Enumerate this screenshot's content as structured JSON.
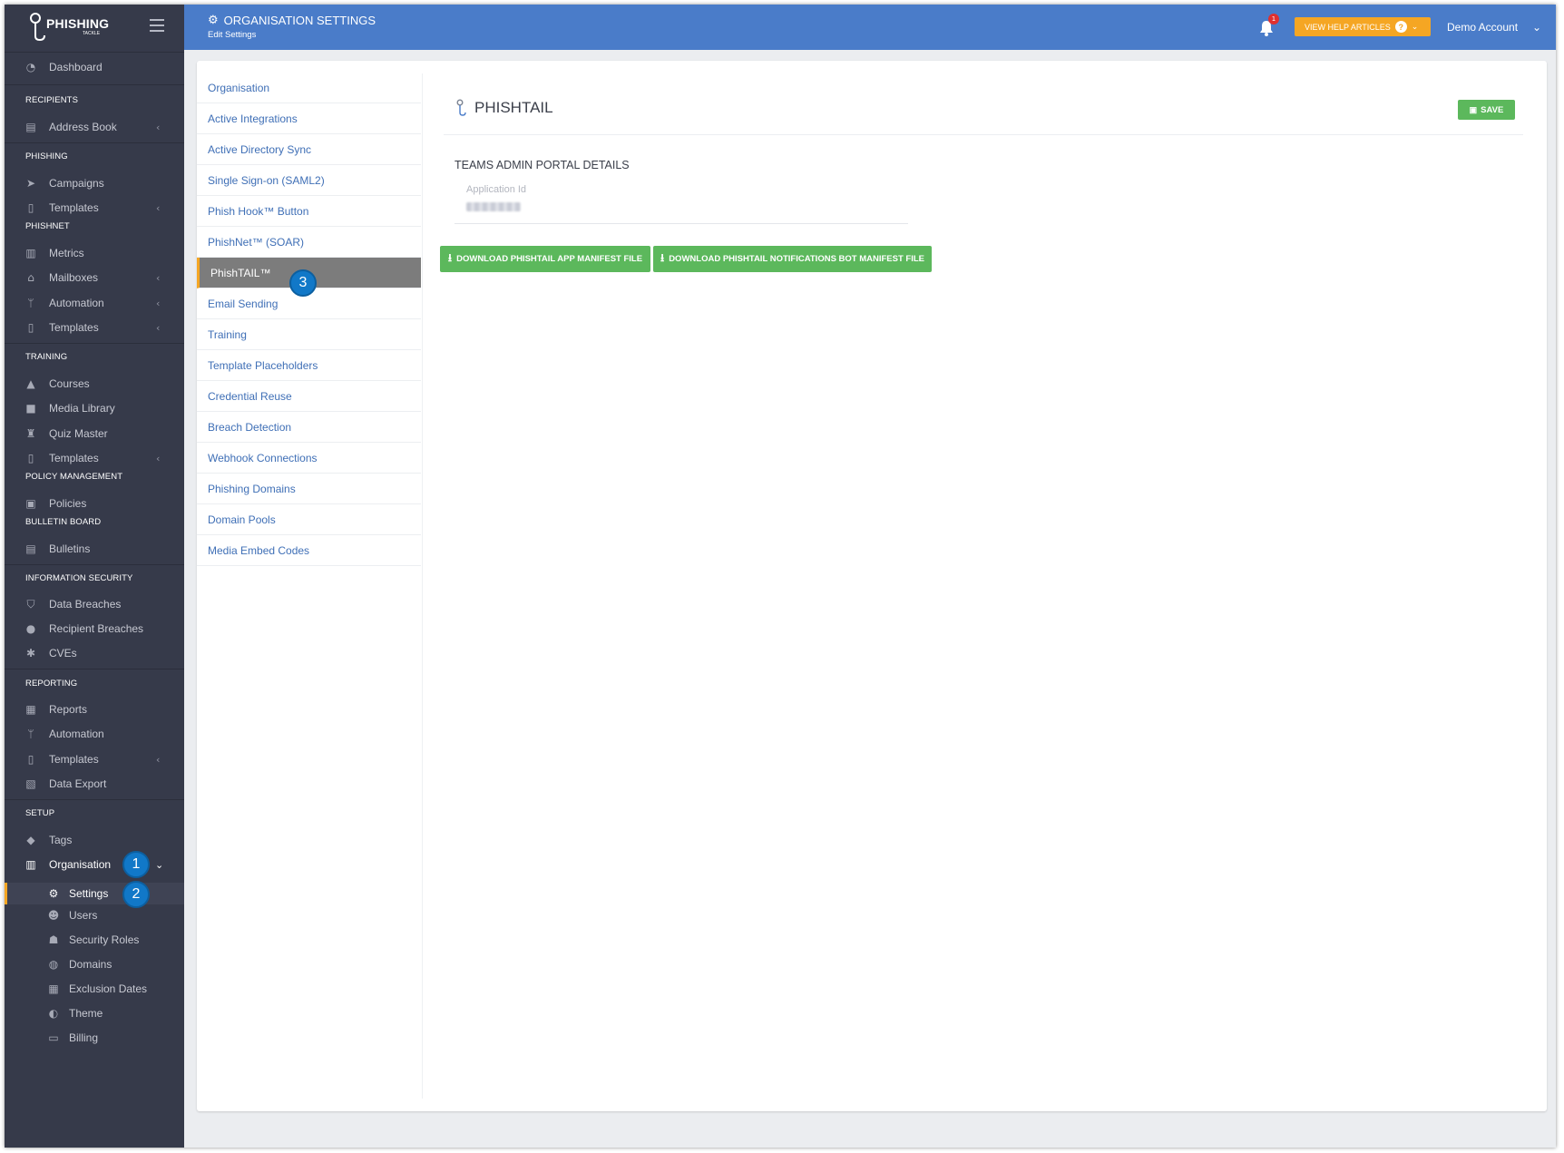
{
  "app": {
    "logo_text": "PHISHING",
    "logo_sub": "TACKLE"
  },
  "header": {
    "title": "ORGANISATION SETTINGS",
    "subtitle": "Edit Settings",
    "notification_count": "1",
    "help_label": "VIEW HELP ARTICLES",
    "account_label": "Demo Account"
  },
  "sidebar": {
    "dashboard": "Dashboard",
    "recipients_head": "RECIPIENTS",
    "address_book": "Address Book",
    "phishing_head": "PHISHING",
    "campaigns": "Campaigns",
    "phishing_templates": "Templates",
    "phishnet_head": "PHISHNET",
    "metrics": "Metrics",
    "mailboxes": "Mailboxes",
    "phishnet_automation": "Automation",
    "phishnet_templates": "Templates",
    "training_head": "TRAINING",
    "courses": "Courses",
    "media_library": "Media Library",
    "quiz_master": "Quiz Master",
    "training_templates": "Templates",
    "policy_head": "POLICY MANAGEMENT",
    "policies": "Policies",
    "bulletin_head": "BULLETIN BOARD",
    "bulletins": "Bulletins",
    "infosec_head": "INFORMATION SECURITY",
    "data_breaches": "Data Breaches",
    "recipient_breaches": "Recipient Breaches",
    "cves": "CVEs",
    "reporting_head": "REPORTING",
    "reports": "Reports",
    "reporting_automation": "Automation",
    "reporting_templates": "Templates",
    "data_export": "Data Export",
    "setup_head": "SETUP",
    "tags": "Tags",
    "organisation": "Organisation",
    "settings": "Settings",
    "users": "Users",
    "security_roles": "Security Roles",
    "domains": "Domains",
    "exclusion_dates": "Exclusion Dates",
    "theme": "Theme",
    "billing": "Billing"
  },
  "callouts": {
    "one": "1",
    "two": "2",
    "three": "3"
  },
  "settings_menu": {
    "items": [
      "Organisation",
      "Active Integrations",
      "Active Directory Sync",
      "Single Sign-on (SAML2)",
      "Phish Hook™ Button",
      "PhishNet™ (SOAR)",
      "PhishTAIL™",
      "Email Sending",
      "Training",
      "Template Placeholders",
      "Credential Reuse",
      "Breach Detection",
      "Webhook Connections",
      "Phishing Domains",
      "Domain Pools",
      "Media Embed Codes"
    ],
    "active_index": 6
  },
  "detail": {
    "heading": "PHISHTAIL",
    "save_label": "SAVE",
    "section_title": "TEAMS ADMIN PORTAL DETAILS",
    "field_label": "Application Id",
    "download_app_label": "DOWNLOAD PHISHTAIL APP MANIFEST FILE",
    "download_bot_label": "DOWNLOAD PHISHTAIL NOTIFICATIONS BOT MANIFEST FILE"
  },
  "colors": {
    "sidebar_bg": "#363a4a",
    "header_bg": "#4a7cc9",
    "accent_orange": "#f5a623",
    "success_green": "#5cb85c",
    "link_blue": "#3f6fb6",
    "callout_blue": "#1178c8"
  },
  "icons": {
    "dashboard": "tachometer-icon",
    "address_book": "address-book-icon",
    "campaigns": "paper-plane-icon",
    "templates": "file-icon",
    "metrics": "bar-chart-icon",
    "mailboxes": "inbox-icon",
    "automation": "code-branch-icon",
    "courses": "graduation-cap-icon",
    "media_library": "video-camera-icon",
    "quiz_master": "trophy-icon",
    "policies": "clipboard-check-icon",
    "bulletins": "newspaper-icon",
    "data_breaches": "shield-icon",
    "recipient_breaches": "user-lock-icon",
    "cves": "bug-icon",
    "reports": "print-icon",
    "data_export": "file-excel-icon",
    "tags": "tags-icon",
    "organisation": "building-icon",
    "settings": "gear-icon",
    "users": "users-icon",
    "security_roles": "user-shield-icon",
    "domains": "globe-icon",
    "exclusion_dates": "calendar-icon",
    "theme": "palette-icon",
    "billing": "credit-card-icon"
  }
}
